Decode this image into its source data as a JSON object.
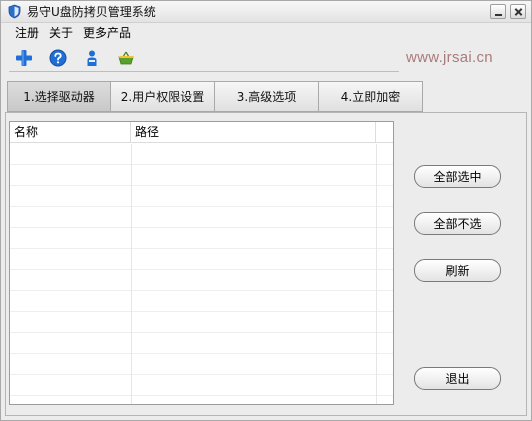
{
  "window": {
    "title": "易守U盘防拷贝管理系统",
    "icons": {
      "app": "shield-icon",
      "minimize": "minimize-icon",
      "close": "close-icon"
    }
  },
  "menu": {
    "items": [
      "注册",
      "关于",
      "更多产品"
    ]
  },
  "toolbar": {
    "buttons": [
      {
        "icon": "plus-icon",
        "color": "#1f6fd6"
      },
      {
        "icon": "help-icon",
        "color": "#1f6fd6"
      },
      {
        "icon": "user-icon",
        "color": "#1f6fd6"
      },
      {
        "icon": "basket-icon",
        "color": "#5aa02c"
      }
    ],
    "watermark": "www.jrsai.cn"
  },
  "tabs": [
    {
      "label": "1.选择驱动器",
      "active": true
    },
    {
      "label": "2.用户权限设置",
      "active": false
    },
    {
      "label": "3.高级选项",
      "active": false
    },
    {
      "label": "4.立即加密",
      "active": false
    }
  ],
  "list": {
    "columns": [
      "名称",
      "路径",
      ""
    ],
    "rows": []
  },
  "buttons": {
    "select_all": "全部选中",
    "select_none": "全部不选",
    "refresh": "刷新",
    "exit": "退出"
  }
}
